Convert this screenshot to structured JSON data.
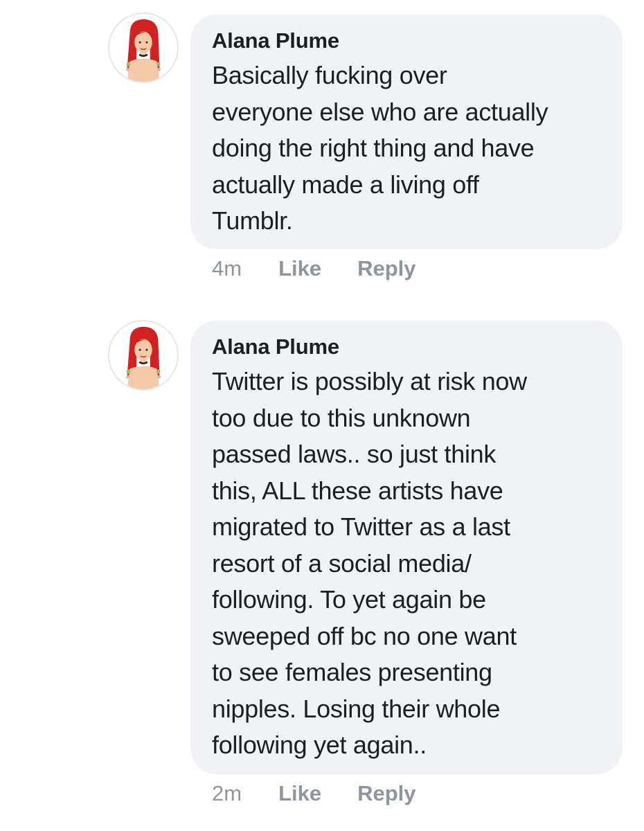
{
  "comments": [
    {
      "author": "Alana Plume",
      "lines": [
        "Basically fucking over",
        "everyone else who are actually",
        "doing the right thing and have",
        "actually made a living off",
        "Tumblr."
      ],
      "time": "4m",
      "like_label": "Like",
      "reply_label": "Reply"
    },
    {
      "author": "Alana Plume",
      "lines": [
        "Twitter is possibly at risk now",
        "too due to this unknown",
        "passed laws.. so just think",
        "this, ALL these artists have",
        "migrated to Twitter as a last",
        "resort of a social media/",
        "following. To yet again be",
        "sweeped off bc no one want",
        "to see females presenting",
        "nipples. Losing their whole",
        "following yet again.."
      ],
      "time": "2m",
      "like_label": "Like",
      "reply_label": "Reply"
    }
  ],
  "colors": {
    "bubble": "#f0f2f5",
    "text": "#1c1e21",
    "meta": "#90949c",
    "hair": "#d32020"
  }
}
